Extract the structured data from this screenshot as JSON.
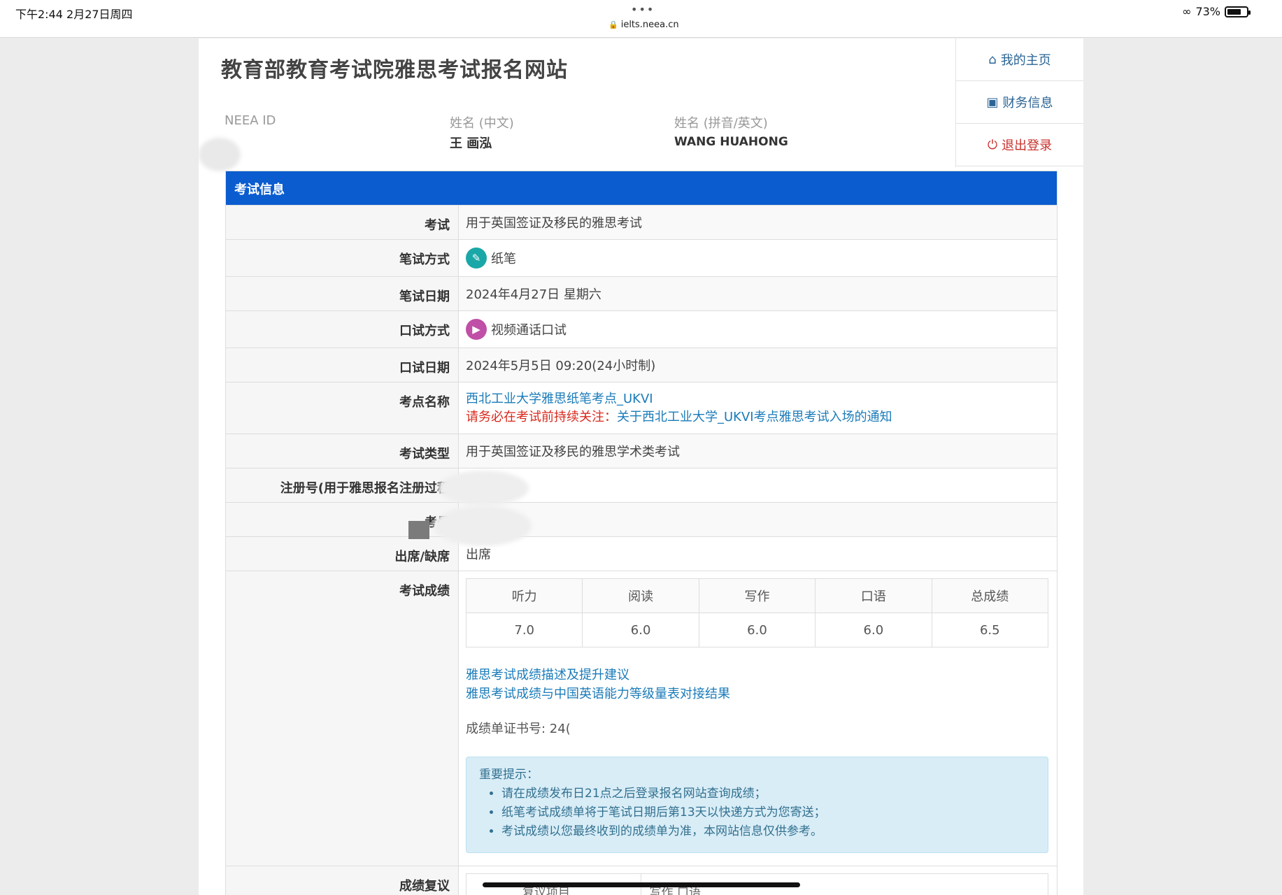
{
  "status_bar": {
    "time": "下午2:44   2月27日周四",
    "dots": "•••",
    "url": "ielts.neea.cn",
    "battery": "73%",
    "battery_level": 0.73
  },
  "header": {
    "site_title": "教育部教育考试院雅思考试报名网站",
    "neea_id_label": "NEEA ID",
    "name_cn_label": "姓名 (中文)",
    "name_cn_value": "王  画泓",
    "name_en_label": "姓名 (拼音/英文)",
    "name_en_value": "WANG  HUAHONG"
  },
  "sidenav": {
    "home": "我的主页",
    "finance": "财务信息",
    "logout": "退出登录"
  },
  "exam": {
    "heading": "考试信息",
    "exam_label": "考试",
    "exam_value": "用于英国签证及移民的雅思考试",
    "written_mode_label": "笔试方式",
    "written_mode_value": "纸笔",
    "written_date_label": "笔试日期",
    "written_date_value": "2024年4月27日 星期六",
    "speaking_mode_label": "口试方式",
    "speaking_mode_value": "视频通话口试",
    "speaking_date_label": "口试日期",
    "speaking_date_value": "2024年5月5日 09:20(24小时制)",
    "center_label": "考点名称",
    "center_value": "西北工业大学雅思纸笔考点_UKVI",
    "notice_prefix": "请务必在考试前持续关注：",
    "notice_link": "关于西北工业大学_UKVI考点雅思考试入场的通知",
    "type_label": "考试类型",
    "type_value": "用于英国签证及移民的雅思学术类考试",
    "reg_label": "注册号(用于雅思报名注册过程",
    "candidate_label": "考号",
    "attendance_label": "出席/缺席",
    "attendance_value": "出席",
    "scores_label": "考试成绩",
    "score_headers": [
      "听力",
      "阅读",
      "写作",
      "口语",
      "总成绩"
    ],
    "score_values": [
      "7.0",
      "6.0",
      "6.0",
      "6.0",
      "6.5"
    ],
    "link1": "雅思考试成绩描述及提升建议",
    "link2": "雅思考试成绩与中国英语能力等级量表对接结果",
    "cert_label": "成绩单证书号: 24(",
    "notice_title": "重要提示：",
    "notice_items": [
      "请在成绩发布日21点之后登录报名网站查询成绩；",
      "纸笔考试成绩单将于笔试日期后第13天以快递方式为您寄送；",
      "考试成绩以您最终收到的成绩单为准，本网站信息仅供参考。"
    ],
    "review_label": "成绩复议",
    "review_col1": "复议项目",
    "review_col2": "写作 口语"
  },
  "colors": {
    "panel_heading": "#0a5ccf",
    "link": "#1a7bb9",
    "warn": "#d9281c",
    "alert_bg": "#d9edf7"
  },
  "icons": {
    "written": "pencil-icon",
    "speaking": "video-camera-icon",
    "home": "home-icon",
    "finance": "briefcase-icon",
    "logout": "power-icon"
  }
}
